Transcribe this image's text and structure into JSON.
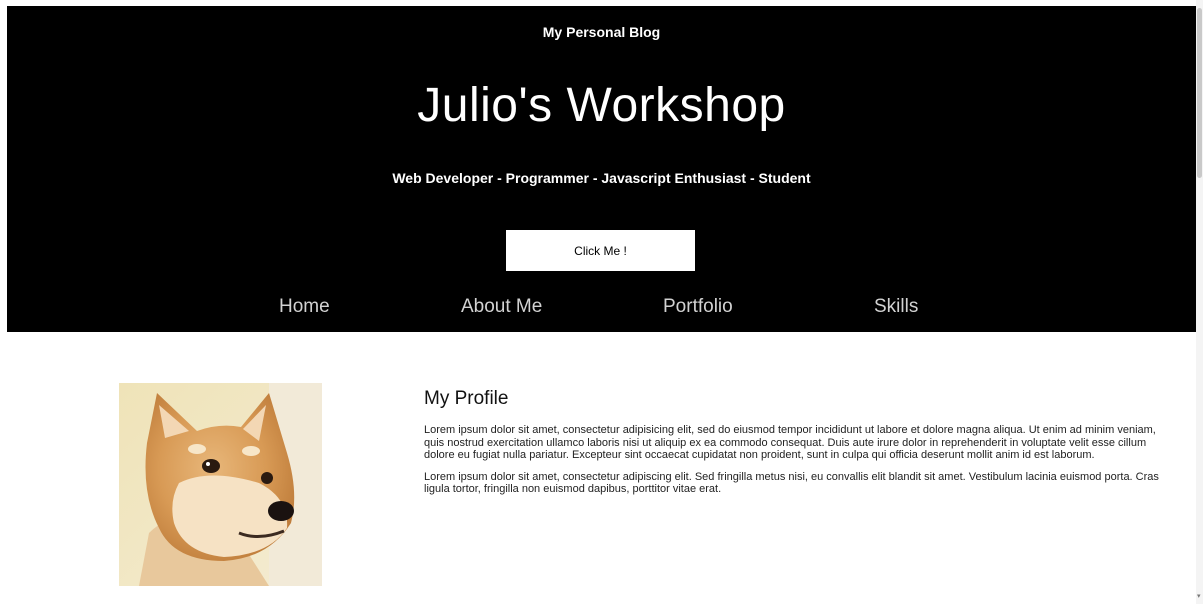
{
  "header": {
    "small_title": "My Personal Blog",
    "title": "Julio's Workshop",
    "tagline": "Web Developer - Programmer - Javascript Enthusiast - Student",
    "cta_label": "Click Me !",
    "background_color": "#000000"
  },
  "nav": {
    "items": [
      {
        "label": "Home"
      },
      {
        "label": "About Me"
      },
      {
        "label": "Portfolio"
      },
      {
        "label": "Skills"
      }
    ]
  },
  "profile": {
    "heading": "My Profile",
    "paragraph1": "Lorem ipsum dolor sit amet, consectetur adipisicing elit, sed do eiusmod tempor incididunt ut labore et dolore magna aliqua. Ut enim ad minim veniam, quis nostrud exercitation ullamco laboris nisi ut aliquip ex ea commodo consequat. Duis aute irure dolor in reprehenderit in voluptate velit esse cillum dolore eu fugiat nulla pariatur. Excepteur sint occaecat cupidatat non proident, sunt in culpa qui officia deserunt mollit anim id est laborum.",
    "paragraph2": "Lorem ipsum dolor sit amet, consectetur adipiscing elit. Sed fringilla metus nisi, eu convallis elit blandit sit amet. Vestibulum lacinia euismod porta. Cras ligula tortor, fringilla non euismod dapibus, porttitor vitae erat.",
    "photo_icon": "shiba-dog-photo"
  }
}
